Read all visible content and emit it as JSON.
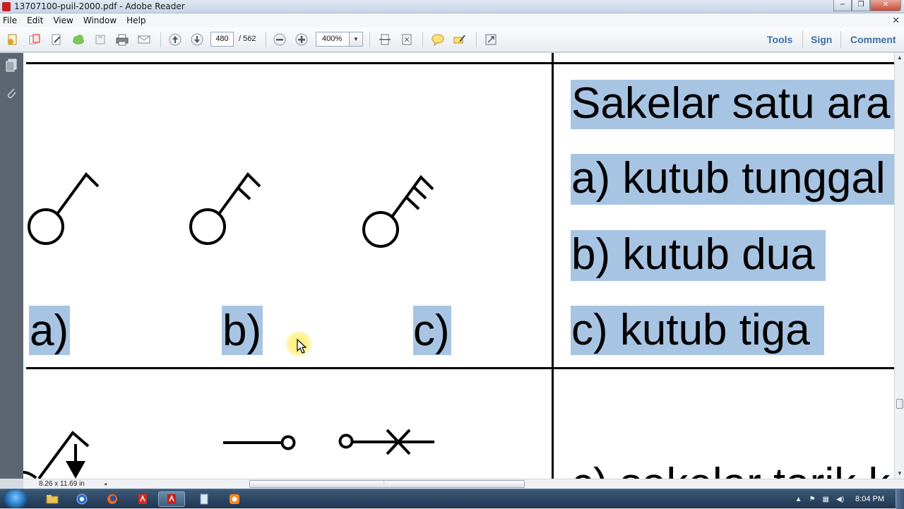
{
  "window": {
    "title": "13707100-puil-2000.pdf - Adobe Reader",
    "minimize": "−",
    "maximize": "❐",
    "close": "✕"
  },
  "menu": [
    "File",
    "Edit",
    "View",
    "Window",
    "Help"
  ],
  "toolbar": {
    "current_page": "480",
    "total_pages": "/ 562",
    "zoom": "400%",
    "tools_label": "Tools",
    "sign_label": "Sign",
    "comment_label": "Comment"
  },
  "document": {
    "labels": [
      "a)",
      "b)",
      "c)"
    ],
    "right_lines": [
      "Sakelar satu ara",
      "a)  kutub tunggal",
      "b)  kutub dua",
      "c)  kutub tiga"
    ],
    "bottom_partial": "c)  sakelar tarik k"
  },
  "status": {
    "page_size": "8.26 x 11.69 in"
  },
  "taskbar": {
    "clock": "8:04 PM"
  },
  "colors": {
    "highlight": "#a7c4e3",
    "accent": "#3b6ea5"
  }
}
